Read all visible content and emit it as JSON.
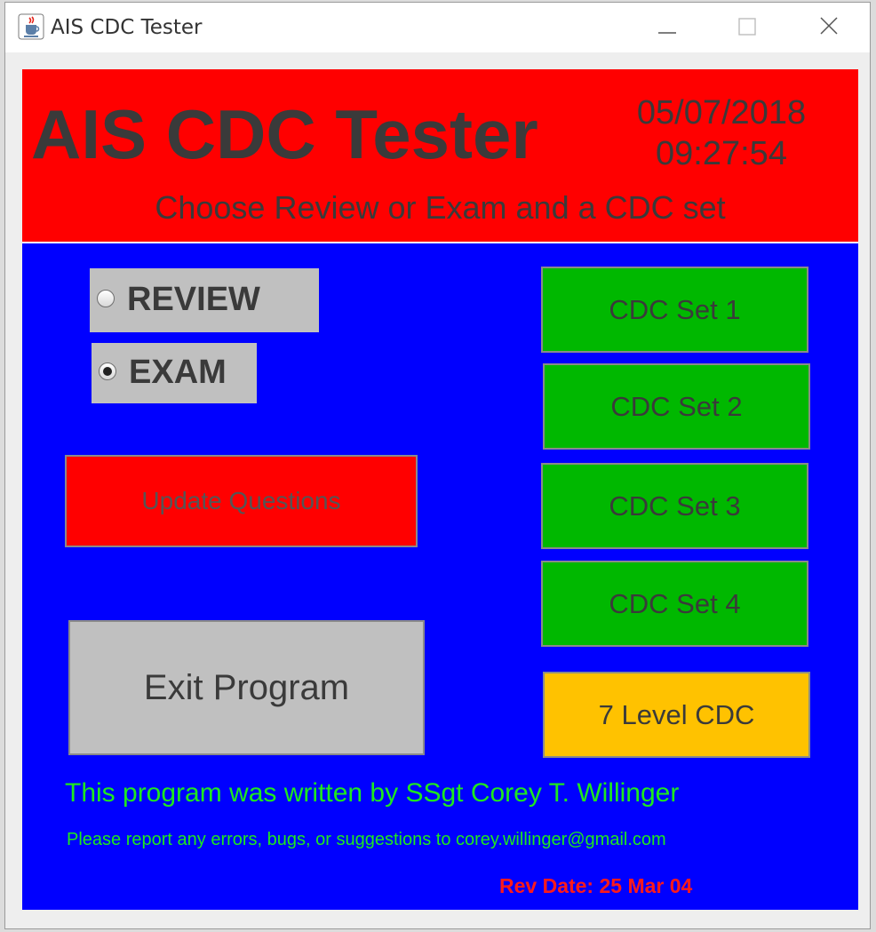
{
  "window": {
    "title": "AIS CDC Tester"
  },
  "header": {
    "title": "AIS CDC Tester",
    "date": "05/07/2018",
    "time": "09:27:54",
    "subtitle": "Choose Review or Exam and a CDC set"
  },
  "mode": {
    "review_label": "REVIEW",
    "exam_label": "EXAM",
    "selected": "EXAM"
  },
  "buttons": {
    "update": "Update Questions",
    "exit": "Exit Program",
    "cdc_sets": [
      "CDC Set 1",
      "CDC Set 2",
      "CDC Set 3",
      "CDC Set 4"
    ],
    "seven_level": "7 Level CDC"
  },
  "footer": {
    "credit": "This program was written by SSgt Corey T. Willinger",
    "report": "Please report any errors, bugs, or suggestions to corey.willinger@gmail.com",
    "rev_date": "Rev Date: 25 Mar 04"
  },
  "colors": {
    "panel_bg": "#0000ff",
    "header_bg": "#ff0000",
    "set_button": "#00b800",
    "seven_level_button": "#ffc200",
    "exit_button": "#c0c0c0",
    "credit_text": "#1ee81e",
    "rev_text": "#ff1a1a"
  }
}
